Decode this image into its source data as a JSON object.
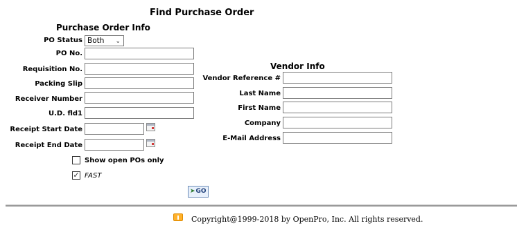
{
  "page": {
    "title": "Find Purchase Order"
  },
  "purchase_order_info": {
    "heading": "Purchase Order Info",
    "po_status": {
      "label": "PO Status",
      "selected": "Both"
    },
    "po_no": {
      "label": "PO No.",
      "value": ""
    },
    "requisition_no": {
      "label": "Requisition No.",
      "value": ""
    },
    "packing_slip": {
      "label": "Packing Slip",
      "value": ""
    },
    "receiver_number": {
      "label": "Receiver Number",
      "value": ""
    },
    "ud_fld1": {
      "label": "U.D. fld1",
      "value": ""
    },
    "receipt_start_date": {
      "label": "Receipt Start Date",
      "value": ""
    },
    "receipt_end_date": {
      "label": "Receipt End Date",
      "value": ""
    },
    "show_open_pos_only": {
      "label": "Show open POs only",
      "checked": false
    },
    "fast": {
      "label": "FAST",
      "checked": true
    }
  },
  "vendor_info": {
    "heading": "Vendor Info",
    "vendor_reference": {
      "label": "Vendor Reference #",
      "value": ""
    },
    "last_name": {
      "label": "Last Name",
      "value": ""
    },
    "first_name": {
      "label": "First Name",
      "value": ""
    },
    "company": {
      "label": "Company",
      "value": ""
    },
    "email": {
      "label": "E-Mail Address",
      "value": ""
    }
  },
  "actions": {
    "go_label": "GO"
  },
  "footer": {
    "copyright": "Copyright@1999-2018 by OpenPro, Inc. All rights reserved."
  },
  "icons": {
    "calendar": "calendar-icon",
    "go": "go-arrow-icon",
    "logo": "openpro-logo-icon",
    "chevron": "chevron-down-icon"
  }
}
